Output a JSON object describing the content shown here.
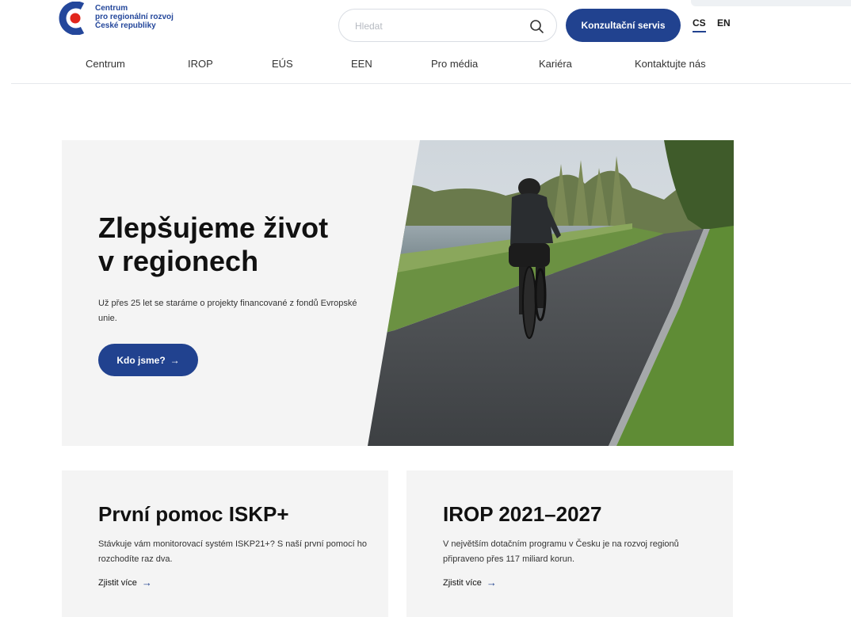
{
  "logo": {
    "line1": "Centrum",
    "line2": "pro regionální rozvoj",
    "line3": "České republiky"
  },
  "search": {
    "placeholder": "Hledat",
    "icon": "search-icon"
  },
  "header": {
    "consult_label": "Konzultační servis",
    "lang_cs": "CS",
    "lang_en": "EN"
  },
  "nav": {
    "items": [
      {
        "label": "Centrum"
      },
      {
        "label": "IROP"
      },
      {
        "label": "EÚS"
      },
      {
        "label": "EEN"
      },
      {
        "label": "Pro média"
      },
      {
        "label": "Kariéra"
      },
      {
        "label": "Kontaktujte nás"
      }
    ]
  },
  "hero": {
    "title_line1": "Zlepšujeme život",
    "title_line2": "v regionech",
    "text": "Už přes 25 let se staráme o projekty financované z fondů Evropské unie.",
    "button_label": "Kdo jsme?",
    "button_icon": "arrow-right-icon"
  },
  "cards": [
    {
      "title": "První pomoc ISKP+",
      "text": "Stávkuje vám monitorovací systém ISKP21+? S naší první pomocí ho rozchodíte raz dva.",
      "link": "Zjistit více"
    },
    {
      "title": "IROP 2021–2027",
      "text": "V největším dotačním programu v Česku je na rozvoj regionů připraveno přes 117 miliard korun.",
      "link": "Zjistit více"
    }
  ],
  "colors": {
    "brand_blue": "#21428f",
    "brand_red": "#e1251b",
    "panel_gray": "#f4f4f4"
  }
}
